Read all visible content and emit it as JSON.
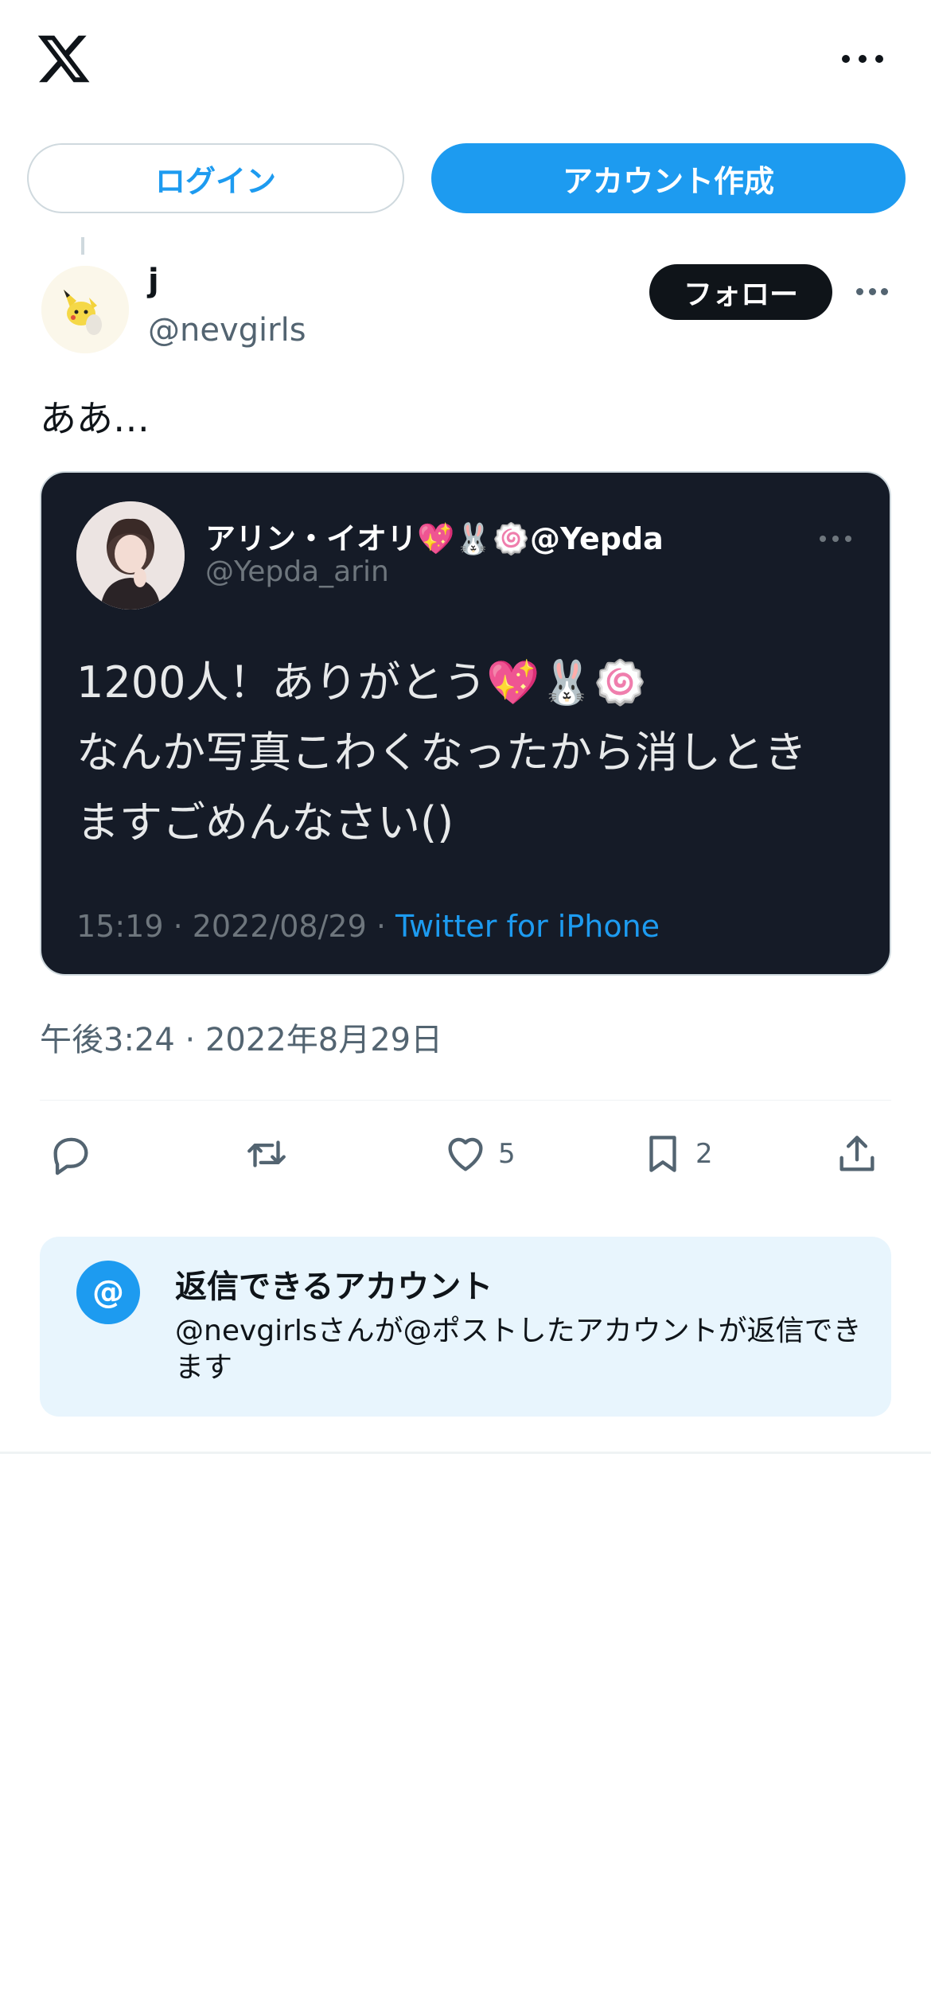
{
  "header": {
    "logo_icon": "x-logo-icon",
    "more_icon": "more-horizontal-icon"
  },
  "auth": {
    "login_label": "ログイン",
    "signup_label": "アカウント作成"
  },
  "post": {
    "author_name": "j",
    "author_handle": "@nevgirls",
    "follow_label": "フォロー",
    "text": "ああ…",
    "timestamp": "午後3:24 · 2022年8月29日"
  },
  "embedded_image": {
    "name": "アリン・イオリ💖🐰🍥@Yepda",
    "handle": "@Yepda_arin",
    "text_lines": [
      "1200人！ありがとう💖🐰🍥",
      "なんか写真こわくなったから消しとき",
      "ますごめんなさい()"
    ],
    "meta_time": "15:19 · 2022/08/29 · ",
    "meta_source": "Twitter for iPhone"
  },
  "actions": {
    "reply_icon": "reply-icon",
    "retweet_icon": "retweet-icon",
    "like_icon": "heart-icon",
    "like_count": "5",
    "bookmark_icon": "bookmark-icon",
    "bookmark_count": "2",
    "share_icon": "share-icon"
  },
  "reply_settings": {
    "badge": "@",
    "title": "返信できるアカウント",
    "description": "@nevgirlsさんが@ポストしたアカウントが返信できます"
  },
  "colors": {
    "accent": "#1d9bf0",
    "text": "#0f1419",
    "muted": "#536471",
    "card_bg": "#151b27",
    "reply_bg": "#e8f5fd"
  }
}
